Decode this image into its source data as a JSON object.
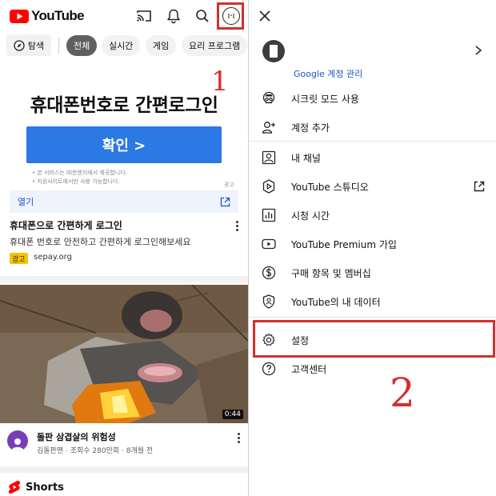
{
  "left": {
    "logo_text": "YouTube",
    "chips": {
      "explore": "탐색",
      "items": [
        "전체",
        "실시간",
        "게임",
        "요리 프로그램"
      ]
    },
    "annotation_1": "1",
    "ad": {
      "banner_title": "휴대폰번호로 간편로그인",
      "button_label": "확인 >",
      "disclaimer_1": "• 본 서비스는 ㈜한엔지에서 제공합니다.",
      "disclaimer_2": "• 지원사이트에서만 사용 가능합니다.",
      "small_tag": "광고",
      "open_label": "열기",
      "headline": "휴대폰으로 간편하게 로그인",
      "description": "휴대폰 번호로 안전하고 간편하게 로그인해보세요",
      "badge": "광고",
      "domain": "sepay.org"
    },
    "video": {
      "duration": "0:44",
      "title": "돌판 삼겹살의 위험성",
      "meta": "김돌판맨 · 조회수 280만회 · 8개월 전"
    },
    "shorts_label": "Shorts"
  },
  "right": {
    "manage_account": "Google 계정 관리",
    "menu": {
      "incognito": "시크릿 모드 사용",
      "add_account": "계정 추가",
      "my_channel": "내 채널",
      "studio": "YouTube 스튜디오",
      "watch_time": "시청 시간",
      "premium": "YouTube Premium 가입",
      "purchases": "구매 항목 및 멤버십",
      "your_data": "YouTube의 내 데이터",
      "settings": "설정",
      "help": "고객센터"
    },
    "annotation_2": "2"
  },
  "colors": {
    "youtube_red": "#ff0000",
    "annotation_red": "#d32f2f",
    "ad_button_blue": "#2a79e4",
    "link_blue": "#1a56c7"
  }
}
